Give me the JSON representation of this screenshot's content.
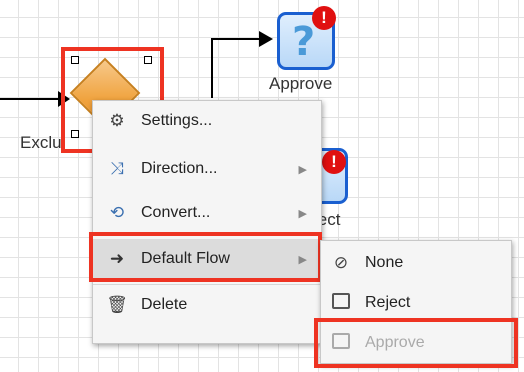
{
  "canvas": {
    "approve_task": {
      "label": "Approve",
      "icon": "user-task-question-icon"
    },
    "reject_task": {
      "label_fragment": "ject"
    },
    "gateway": {
      "label_fragment": "Exclu"
    }
  },
  "context_menu": {
    "items": [
      {
        "label": "Settings...",
        "icon": "gear-icon",
        "submenu": false
      },
      {
        "label": "Direction...",
        "icon": "shuffle-icon",
        "submenu": true
      },
      {
        "label": "Convert...",
        "icon": "convert-icon",
        "submenu": true
      },
      {
        "label": "Default Flow",
        "icon": "arrow-right-icon",
        "submenu": true,
        "highlighted": true
      },
      {
        "label": "Delete",
        "icon": "trash-icon",
        "submenu": false
      }
    ]
  },
  "default_flow_submenu": {
    "items": [
      {
        "label": "None",
        "icon": "no-entry-icon"
      },
      {
        "label": "Reject",
        "icon": "checkbox-icon"
      },
      {
        "label": "Approve",
        "icon": "checkbox-icon",
        "disabled": true
      }
    ]
  },
  "colors": {
    "highlight": "#ee3322",
    "task_border": "#1a5fd0",
    "alert": "#e01010"
  }
}
